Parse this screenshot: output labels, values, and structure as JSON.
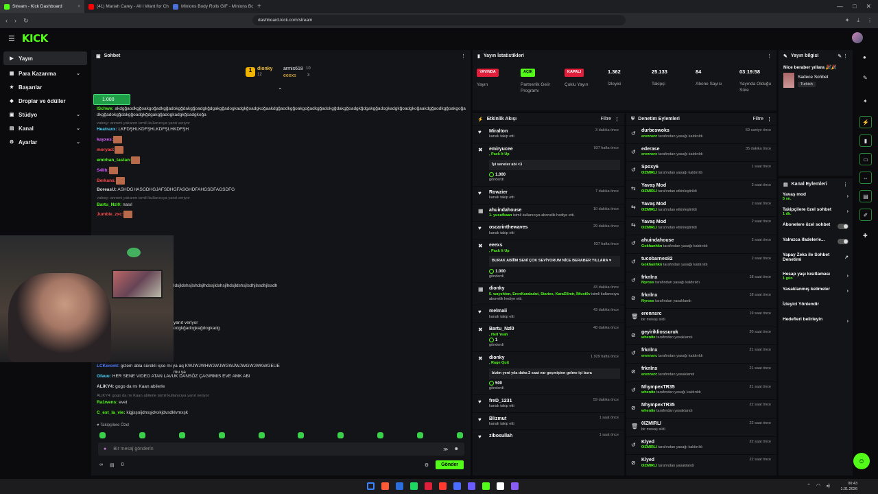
{
  "browser": {
    "tabs": [
      {
        "title": "Stream - Kick Dashboard",
        "color": "#53fc18",
        "active": true
      },
      {
        "title": "(41) Mariah Carey - All I Want for Ch",
        "color": "#ff0000",
        "active": false
      },
      {
        "title": "Minions Body Rolls GIF - Minions Bo",
        "color": "#4a6fd8",
        "active": false
      }
    ],
    "url": "dashboard.kick.com/stream"
  },
  "logo": "KICK",
  "sidebar": {
    "items": [
      {
        "label": "Yayın",
        "chev": ""
      },
      {
        "label": "Para Kazanma",
        "chev": "⌄"
      },
      {
        "label": "Başarılar",
        "chev": ""
      },
      {
        "label": "Droplar ve ödüller",
        "chev": ""
      },
      {
        "label": "Stüdyo",
        "chev": "⌄"
      },
      {
        "label": "Kanal",
        "chev": "⌄"
      },
      {
        "label": "Ayarlar",
        "chev": "⌄"
      }
    ]
  },
  "chat": {
    "title": "Sohbet",
    "podium": {
      "first": {
        "name": "dionky",
        "count": "12"
      },
      "second": {
        "name": "armis618",
        "count": "10"
      },
      "third": {
        "name": "eeexs",
        "count": "3"
      }
    },
    "pinned_amount": "1.000",
    "messages": [
      {
        "user": "ISchwe:",
        "color": "#53fc18",
        "text": "akdgğaodkgğoakgoğadkgğadokgğdakgğoadgkğdgakgğadogkadgkğoadgkoğaakdgğaodkgğoakgoğadkgğadokgğdakgğoadgkğdgakgğadogkadgkğoadgkoğaakdgğaodkgğoakgoğadkgğadokgğdakgğoadgkğdgakgğadogkadgkğoadgkoğa"
      },
      {
        "reply": "valesy: anneni yakarım ismili kullanıcıya yanıt veriyor",
        "user": "Heatraxx:",
        "color": "#4dd3ff",
        "text": "LKFDŞHLKDFŞHLKDFŞLHKDFŞH"
      },
      {
        "user": "kayxes:",
        "color": "#d75cff",
        "text": ""
      },
      {
        "user": "moryad:",
        "color": "#ff4a4a",
        "text": ""
      },
      {
        "user": "emirhan_tastan:",
        "color": "#53fc18",
        "text": ""
      },
      {
        "user": "S4lih:",
        "color": "#d75cff",
        "text": ""
      },
      {
        "user": "Berkans:",
        "color": "#ff4a4a",
        "text": ""
      },
      {
        "user": "BoreasU:",
        "color": "#dddddd",
        "text": "ASHDGHASGDHGJAFSDHGFASGHDFAHGSDFAGSDFG"
      },
      {
        "reply": "valesy: anneni yakarım ismili kullanıcıya yanıt veriyor",
        "user": "Bartu_Nzl0:",
        "color": "#53fc18",
        "text": "nasıl"
      },
      {
        "user": "Jumble_zxc:",
        "color": "#ff4a4a",
        "text": ""
      }
    ],
    "partial_lines": [
      "ldsjldshsjlshdsjlhdssjldshsjlhdsjldshsjlsdhjlssdhjlssdh",
      "yanıt veriyor",
      "odgkğadogkağdogkadg",
      "mu ya"
    ],
    "bottom_messages": [
      {
        "user": "LCKeremt:",
        "color": "#4d7dff",
        "text": "gizem abla sürekli içse mi ya aq KWJWJWHWJWJWGWJWJWGWJWKWGEUE"
      },
      {
        "user": "Ofauu:",
        "color": "#4dd3ff",
        "text": "HER SENE VIDEO ATAN LAVUK DANSÖZ ÇAGIRMIS EVE AMK ABI"
      },
      {
        "user": "ALiKY4:",
        "color": "#dddddd",
        "text": "gogo da mı Kaan abilerle"
      },
      {
        "reply": "ALiKY4: gogo da mı Kaan abilerle isimli kullanıcıya yanıt veriyor",
        "user": "Ra1wens:",
        "color": "#53fc18",
        "text": "evet"
      },
      {
        "user": "C_est_la_vie:",
        "color": "#53fc18",
        "text": "kigjsşoijdnsşjdvxkjdvsdklvmxşk"
      }
    ],
    "followers_only": "Takipçilere Özel",
    "input_placeholder": "Bir mesaj gönderin",
    "footer_count": "0",
    "send_label": "Gönder"
  },
  "stats": {
    "title": "Yayın İstatistikleri",
    "items": [
      {
        "tag": "YAYINDA",
        "tag_color": "#e0203a",
        "label": "Yayın"
      },
      {
        "tag": "AÇIK",
        "tag_color": "#53fc18",
        "label": "Partnerlik Gelir Programı"
      },
      {
        "tag": "KAPALI",
        "tag_color": "#e0203a",
        "label": "Çoklu Yayın"
      },
      {
        "value": "1.362",
        "label": "İzleyici"
      },
      {
        "value": "25.133",
        "label": "Takipçi"
      },
      {
        "value": "84",
        "label": "Abone Sayısı"
      },
      {
        "value": "03:19:58",
        "label": "Yayında Olduğu Süre"
      }
    ]
  },
  "activity": {
    "title": "Etkinlik Akışı",
    "filter": "Filtre",
    "rows": [
      {
        "icon": "♥",
        "name": "Miralton",
        "sub": "kanalı takip etti",
        "time": "3 dakika önce"
      },
      {
        "icon": "✖",
        "name": "emiryucee",
        "green": ", Pack It Up",
        "bubble": "İyi seneler abi <3",
        "amount": "1.000",
        "tail": "gönderdi",
        "time": "937 hafta önce"
      },
      {
        "icon": "♥",
        "name": "Rowzier",
        "sub": "kanalı takip etti",
        "time": "7 dakika önce"
      },
      {
        "icon": "▦",
        "name": "ahuindahouse",
        "green": "1. yusufkaan",
        "sub": " isimli kullanıcıya abonelik hediye etti.",
        "time": "10 dakika önce"
      },
      {
        "icon": "♥",
        "name": "oscarinthewaves",
        "sub": "kanalı takip etti",
        "time": "29 dakika önce"
      },
      {
        "icon": "✖",
        "name": "eeexs",
        "green": ", Pack It Up",
        "bubble": "BURAK ABİİİM SENİ ÇOK SEVİYORUM NİCE BERABER YILLARA ♥",
        "amount": "1.000",
        "tail": "gönderdi",
        "time": "937 hafta önce"
      },
      {
        "icon": "▦",
        "name": "dionky",
        "green": "5. wayshion, ErenKarabulut, Stariex, KaraD3mir, İMust0v",
        "sub": " isimli kullanıcıya abonelik hediye etti.",
        "time": "43 dakika önce"
      },
      {
        "icon": "♥",
        "name": "melmaii",
        "sub": "kanalı takip etti",
        "time": "43 dakika önce"
      },
      {
        "icon": "✖",
        "name": "Bartu_Nzl0",
        "green": ", Hell Yeah",
        "amount": "1",
        "tail": "gönderdi",
        "time": "48 dakika önce"
      },
      {
        "icon": "✖",
        "name": "dionky",
        "green": ", Rage Quit",
        "bubble": "bizim yeni yıla daha 2 saat var geçmişten gelme işi bura",
        "amount": "500",
        "tail": "gönderdi",
        "time": "1.929 hafta önce"
      },
      {
        "icon": "♥",
        "name": "freD_1231",
        "sub": "kanalı takip etti",
        "time": "59 dakika önce"
      },
      {
        "icon": "♥",
        "name": "Blizmut",
        "sub": "kanalı takip etti",
        "time": "1 saat önce"
      },
      {
        "icon": "♥",
        "name": "zibosullah",
        "sub": "",
        "time": "1 saat önce"
      }
    ]
  },
  "moderation": {
    "title": "Denetim Eylemleri",
    "filter": "Filtre",
    "rows": [
      {
        "icon": "↺",
        "name": "durbeswoks",
        "mod": "erennsrc",
        "action": " tarafından yasağı kaldırıldı",
        "time": "59 saniye önce"
      },
      {
        "icon": "↺",
        "name": "ederase",
        "mod": "erennsrc",
        "action": " tarafından yasağı kaldırıldı",
        "time": "35 dakika önce"
      },
      {
        "icon": "↺",
        "name": "Spoxy6",
        "mod": "0IZMIRLI",
        "action": " tarafından yasağı kaldırıldı",
        "time": "1 saat önce"
      },
      {
        "icon": "⇆",
        "name": "Yavaş Mod",
        "mod": "0IZMIRLI",
        "action": " tarafından etkinleştirildi",
        "time": "2 saat önce"
      },
      {
        "icon": "⇆",
        "name": "Yavaş Mod",
        "mod": "0IZMIRLI",
        "action": " tarafından etkinleştirildi",
        "time": "2 saat önce"
      },
      {
        "icon": "⇆",
        "name": "Yavaş Mod",
        "mod": "0IZMIRLI",
        "action": " tarafından etkinleştirildi",
        "time": "2 saat önce"
      },
      {
        "icon": "↺",
        "name": "ahuindahouse",
        "mod": "Gokhanhkn",
        "action": " tarafından yasağı kaldırıldı",
        "time": "2 saat önce"
      },
      {
        "icon": "↺",
        "name": "tucobarnes82",
        "mod": "Gokhanhkn",
        "action": " tarafından yasağı kaldırıldı",
        "time": "2 saat önce"
      },
      {
        "icon": "↺",
        "name": "frknlnx",
        "mod": "Nyross",
        "action": " tarafından yasağı kaldırıldı",
        "time": "18 saat önce"
      },
      {
        "icon": "⊘",
        "name": "frknlnx",
        "mod": "Nyross",
        "action": " tarafından yasaklandı",
        "time": "18 saat önce"
      },
      {
        "icon": "🗑",
        "name": "erennsrc",
        "mod": "",
        "action": "bir mesajı sildi",
        "time": "19 saat önce"
      },
      {
        "icon": "⊘",
        "name": "geyirikliossuruk",
        "mod": "whenite",
        "action": " tarafından yasaklandı",
        "time": "20 saat önce"
      },
      {
        "icon": "↺",
        "name": "frknlnx",
        "mod": "erennsrc",
        "action": " tarafından yasağı kaldırıldı",
        "time": "21 saat önce"
      },
      {
        "icon": "⊘",
        "name": "frknlnx",
        "mod": "erennsrc",
        "action": " tarafından yasaklandı",
        "time": "21 saat önce"
      },
      {
        "icon": "↺",
        "name": "NhympexTR35",
        "mod": "whenite",
        "action": " tarafından yasağı kaldırıldı",
        "time": "21 saat önce"
      },
      {
        "icon": "⊘",
        "name": "NhympexTR35",
        "mod": "whenite",
        "action": " tarafından yasaklandı",
        "time": "22 saat önce"
      },
      {
        "icon": "🗑",
        "name": "0IZMIRLI",
        "mod": "",
        "action": "bir mesajı sildi",
        "time": "22 saat önce"
      },
      {
        "icon": "↺",
        "name": "Klyed",
        "mod": "0IZMIRLI",
        "action": " tarafından yasağı kaldırıldı",
        "time": "22 saat önce"
      },
      {
        "icon": "⊘",
        "name": "Klyed",
        "mod": "0IZMIRLI",
        "action": " tarafından yasaklandı",
        "time": "22 saat önce"
      }
    ]
  },
  "stream_info": {
    "title": "Yayın bilgisi",
    "stream_title": "Nice beraber yıllara 🎉🎉",
    "category": "Sadece Sohbet",
    "language": "Turkish"
  },
  "channel_actions": {
    "title": "Kanal Eylemleri",
    "items": [
      {
        "label": "Yavaş mod",
        "sub": "5 sn.",
        "control": "arrow"
      },
      {
        "label": "Takipçilere özel sohbet",
        "sub": "1 dk.",
        "control": "arrow"
      },
      {
        "label": "Abonelere özel sohbet",
        "sub": "",
        "control": "toggle"
      },
      {
        "label": "Yalnızca ifadelerle...",
        "sub": "",
        "control": "toggle"
      },
      {
        "label": "Yapay Zeka ile Sohbet Denetimi",
        "sub": "",
        "control": "external"
      },
      {
        "label": "Hesap yaşı kısıtlaması",
        "sub": "1 gün",
        "control": "arrow"
      },
      {
        "label": "Yasaklanmış kelimeler",
        "sub": "",
        "control": "arrow"
      },
      {
        "label": "İzleyici Yönlendir",
        "sub": "",
        "control": ""
      },
      {
        "label": "Hedefleri belirleyin",
        "sub": "",
        "control": "arrow"
      }
    ]
  },
  "taskbar": {
    "time": "00:43",
    "date": "1.01.2026",
    "icons": [
      "#3a86ff",
      "#ff5a36",
      "#2a6fdb",
      "#1ed760",
      "#e0203a",
      "#ff3b30",
      "#4a6cff",
      "#6a5cff",
      "#53fc18",
      "#ffffff",
      "#8a5cf6"
    ]
  }
}
